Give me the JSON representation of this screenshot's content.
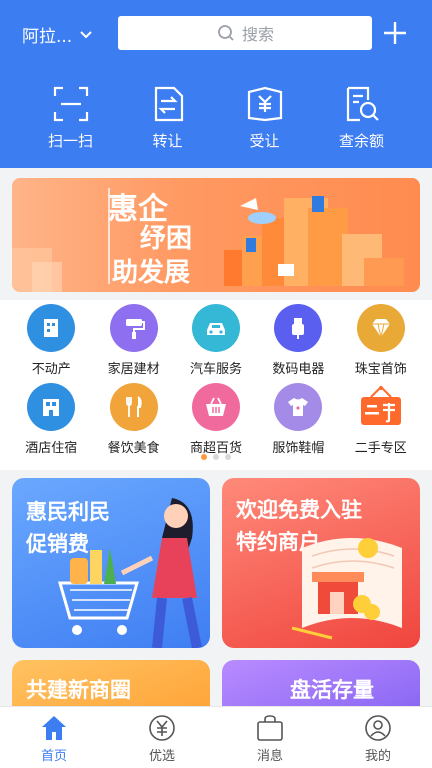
{
  "header": {
    "location": "阿拉...",
    "search_placeholder": "搜索",
    "quick_actions": [
      {
        "label": "扫一扫",
        "icon": "scan-icon"
      },
      {
        "label": "转让",
        "icon": "transfer-icon"
      },
      {
        "label": "受让",
        "icon": "receive-icon"
      },
      {
        "label": "查余额",
        "icon": "check-balance-icon"
      }
    ]
  },
  "banner": {
    "line1": "惠企",
    "line2": "纾困",
    "line3": "助发展"
  },
  "categories": [
    {
      "label": "不动产",
      "icon": "building-icon",
      "color": "#2f8fe0"
    },
    {
      "label": "家居建材",
      "icon": "paint-roller-icon",
      "color": "#8d6ff0"
    },
    {
      "label": "汽车服务",
      "icon": "car-icon",
      "color": "#35b7d6"
    },
    {
      "label": "数码电器",
      "icon": "usb-icon",
      "color": "#5b5ff0"
    },
    {
      "label": "珠宝首饰",
      "icon": "diamond-icon",
      "color": "#e8a937"
    },
    {
      "label": "酒店住宿",
      "icon": "hotel-icon",
      "color": "#2f8fe0"
    },
    {
      "label": "餐饮美食",
      "icon": "fork-knife-icon",
      "color": "#f0a43a"
    },
    {
      "label": "商超百货",
      "icon": "basket-icon",
      "color": "#f06a9e"
    },
    {
      "label": "服饰鞋帽",
      "icon": "tshirt-icon",
      "color": "#a58be8"
    },
    {
      "label": "二手专区",
      "icon": "secondhand-tag-icon",
      "color": "#ff6a2c"
    }
  ],
  "promos": {
    "card1": {
      "line1": "惠民利民",
      "line2": "促销费"
    },
    "card2": {
      "line1": "欢迎免费入驻",
      "line2": "特约商户"
    },
    "card3": {
      "line1": "共建新商圈"
    },
    "card4": {
      "line1": "盘活存量"
    }
  },
  "tabs": [
    {
      "label": "首页",
      "icon": "home-icon",
      "active": true
    },
    {
      "label": "优选",
      "icon": "yuan-coin-icon",
      "active": false
    },
    {
      "label": "消息",
      "icon": "bag-icon",
      "active": false
    },
    {
      "label": "我的",
      "icon": "user-icon",
      "active": false
    }
  ],
  "colors": {
    "primary": "#3d7df2",
    "accent": "#ff9a3c"
  }
}
